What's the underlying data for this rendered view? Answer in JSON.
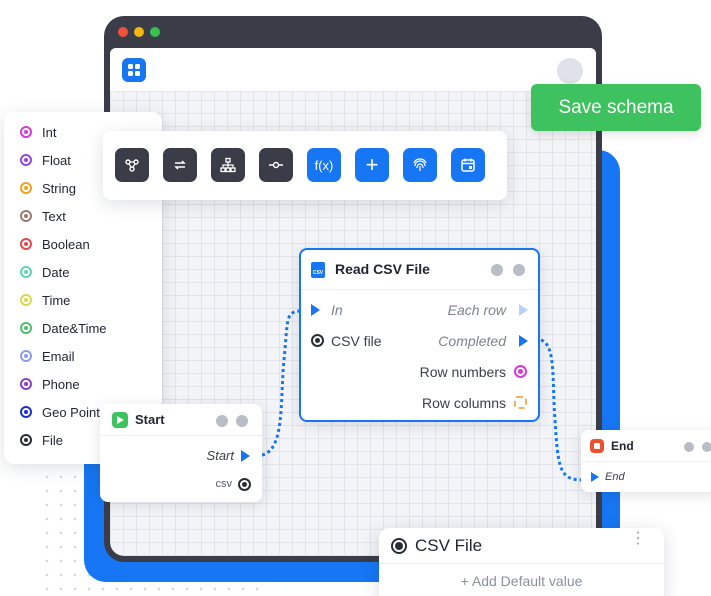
{
  "toolbar_top": {
    "save_label": "Save schema"
  },
  "types": [
    {
      "label": "Int",
      "color": "#d63ad9"
    },
    {
      "label": "Float",
      "color": "#9b44d8"
    },
    {
      "label": "String",
      "color": "#f0a21c"
    },
    {
      "label": "Text",
      "color": "#9a7a6e"
    },
    {
      "label": "Boolean",
      "color": "#e5484d"
    },
    {
      "label": "Date",
      "color": "#5fd3b0"
    },
    {
      "label": "Time",
      "color": "#d8d84a"
    },
    {
      "label": "Date&Time",
      "color": "#4cc06a"
    },
    {
      "label": "Email",
      "color": "#8f9bf0"
    },
    {
      "label": "Phone",
      "color": "#8a3fc8"
    },
    {
      "label": "Geo Point",
      "color": "#1a2fd6"
    },
    {
      "label": "File",
      "color": "#2a2d36"
    }
  ],
  "tools": [
    {
      "icon": "graph-nodes-icon",
      "style": "dark"
    },
    {
      "icon": "swap-arrows-icon",
      "style": "dark"
    },
    {
      "icon": "hierarchy-icon",
      "style": "dark"
    },
    {
      "icon": "commit-node-icon",
      "style": "dark"
    },
    {
      "icon": "function-icon",
      "style": "blue",
      "glyph": "f(x)"
    },
    {
      "icon": "plus-icon",
      "style": "blue",
      "glyph": "+"
    },
    {
      "icon": "fingerprint-icon",
      "style": "blue"
    },
    {
      "icon": "calendar-icon",
      "style": "blue"
    }
  ],
  "read_csv_node": {
    "title": "Read CSV File",
    "in_label": "In",
    "csv_file_label": "CSV file",
    "each_row_label": "Each row",
    "completed_label": "Completed",
    "row_numbers_label": "Row numbers",
    "row_columns_label": "Row columns",
    "badge": "CSV"
  },
  "start_node": {
    "title": "Start",
    "start_port": "Start",
    "csv_port": "csv"
  },
  "end_node": {
    "title": "End",
    "end_port": "End"
  },
  "csv_panel": {
    "title": "CSV File",
    "add_default": "+ Add Default value"
  },
  "colors": {
    "accent": "#1676f3",
    "success": "#3ec15f",
    "dark": "#3a3c48",
    "end_red": "#f0502f",
    "start_green": "#3ec15f"
  }
}
